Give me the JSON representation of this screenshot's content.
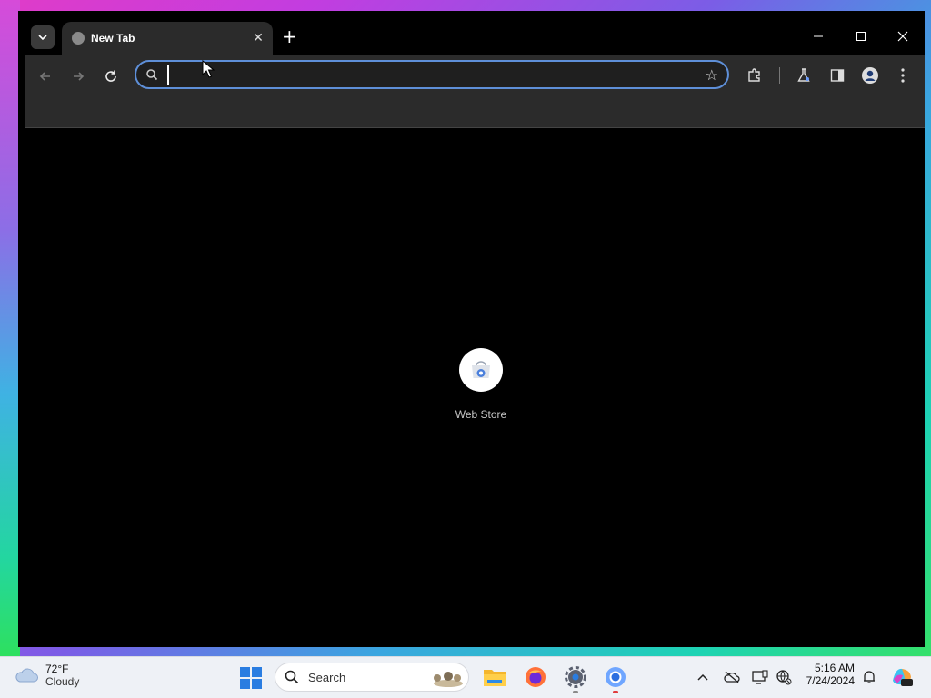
{
  "browser": {
    "tab": {
      "title": "New Tab"
    },
    "omnibox": {
      "value": "",
      "placeholder": ""
    },
    "shortcuts": [
      {
        "label": "Web Store"
      }
    ]
  },
  "taskbar": {
    "weather": {
      "temp": "72°F",
      "desc": "Cloudy"
    },
    "search": {
      "label": "Search"
    },
    "clock": {
      "time": "5:16 AM",
      "date": "7/24/2024"
    }
  },
  "colors": {
    "omnibox_focus": "#5e8fd8",
    "chrome_dark": "#2b2b2b",
    "taskbar_bg": "#eef1f6"
  }
}
